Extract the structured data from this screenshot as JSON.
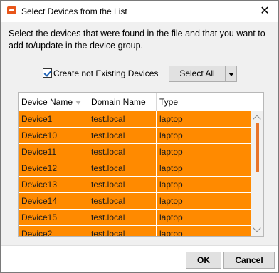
{
  "window": {
    "title": "Select Devices from the List",
    "close_glyph": "✕",
    "app_icon": "app-logo-icon"
  },
  "instruction": "Select the devices that were found in the file and that you want to add to/update in the device group.",
  "options": {
    "create_not_existing_label": "Create not Existing Devices",
    "create_not_existing_checked": true,
    "select_all_label": "Select All"
  },
  "table": {
    "columns": [
      "Device Name",
      "Domain Name",
      "Type",
      ""
    ],
    "rows": [
      {
        "name": "Device1",
        "domain": "test.local",
        "type": "laptop"
      },
      {
        "name": "Device10",
        "domain": "test.local",
        "type": "laptop"
      },
      {
        "name": "Device11",
        "domain": "test.local",
        "type": "laptop"
      },
      {
        "name": "Device12",
        "domain": "test.local",
        "type": "laptop"
      },
      {
        "name": "Device13",
        "domain": "test.local",
        "type": "laptop"
      },
      {
        "name": "Device14",
        "domain": "test.local",
        "type": "laptop"
      },
      {
        "name": "Device15",
        "domain": "test.local",
        "type": "laptop"
      },
      {
        "name": "Device2",
        "domain": "test.local",
        "type": "laptop"
      }
    ],
    "selected_row_color": "#ff8a00"
  },
  "footer": {
    "ok_label": "OK",
    "cancel_label": "Cancel"
  },
  "colors": {
    "accent": "#ff8a00",
    "scroll_thumb": "#e8742a",
    "app_icon": "#e8561a"
  }
}
